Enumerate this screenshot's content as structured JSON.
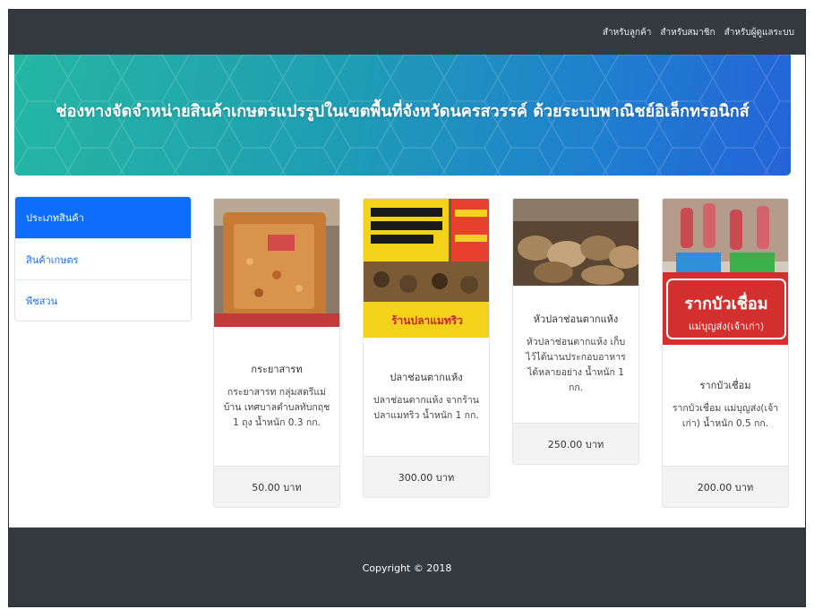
{
  "navbar": {
    "links": [
      "สำหรับลูกค้า",
      "สำหรับสมาชิก",
      "สำหรับผู้ดูแลระบบ"
    ]
  },
  "banner": {
    "title": "ช่องทางจัดจำหน่ายสินค้าเกษตรแปรรูปในเขตพื้นที่จังหวัดนครสวรรค์ ด้วยระบบพาณิชย์อิเล็กทรอนิกส์"
  },
  "sidebar": {
    "items": [
      {
        "label": "ประเภทสินค้า"
      },
      {
        "label": "สินค้าเกษตร"
      },
      {
        "label": "พืชสวน"
      }
    ]
  },
  "products": [
    {
      "title": "กระยาสารท",
      "desc": "กระยาสารท กลุ่มสตรีแม่บ้าน เทศบาลตำบลทับกฤช 1 ถุง น้ำหนัก 0.3 กก.",
      "price": "50.00 บาท"
    },
    {
      "title": "ปลาช่อนตากแห้ง",
      "desc": "ปลาช่อนตากแห้ง จากร้าน ปลาแมทริว น้ำหนัก 1 กก.",
      "price": "300.00 บาท",
      "image_text": "ร้านปลาแมทริว"
    },
    {
      "title": "หัวปลาช่อนตากแห้ง",
      "desc": "หัวปลาช่อนตากแห้ง เก็บไว้ได้นานประกอบอาหารได้หลายอย่าง น้ำหนัก 1 กก.",
      "price": "250.00 บาท"
    },
    {
      "title": "รากบัวเชื่อม",
      "desc": "รากบัวเชื่อม แม่บุญส่ง(เจ้าเก่า) น้ำหนัก 0.5 กก.",
      "price": "200.00 บาท",
      "image_text": "รากบัวเชื่อม",
      "image_subtext": "แม่บุญส่ง(เจ้าเก่า)"
    }
  ],
  "footer": {
    "copyright": "Copyright © 2018"
  },
  "colors": {
    "navbar": "#343a40",
    "active": "#0d6efd",
    "link": "#1a73e8"
  }
}
